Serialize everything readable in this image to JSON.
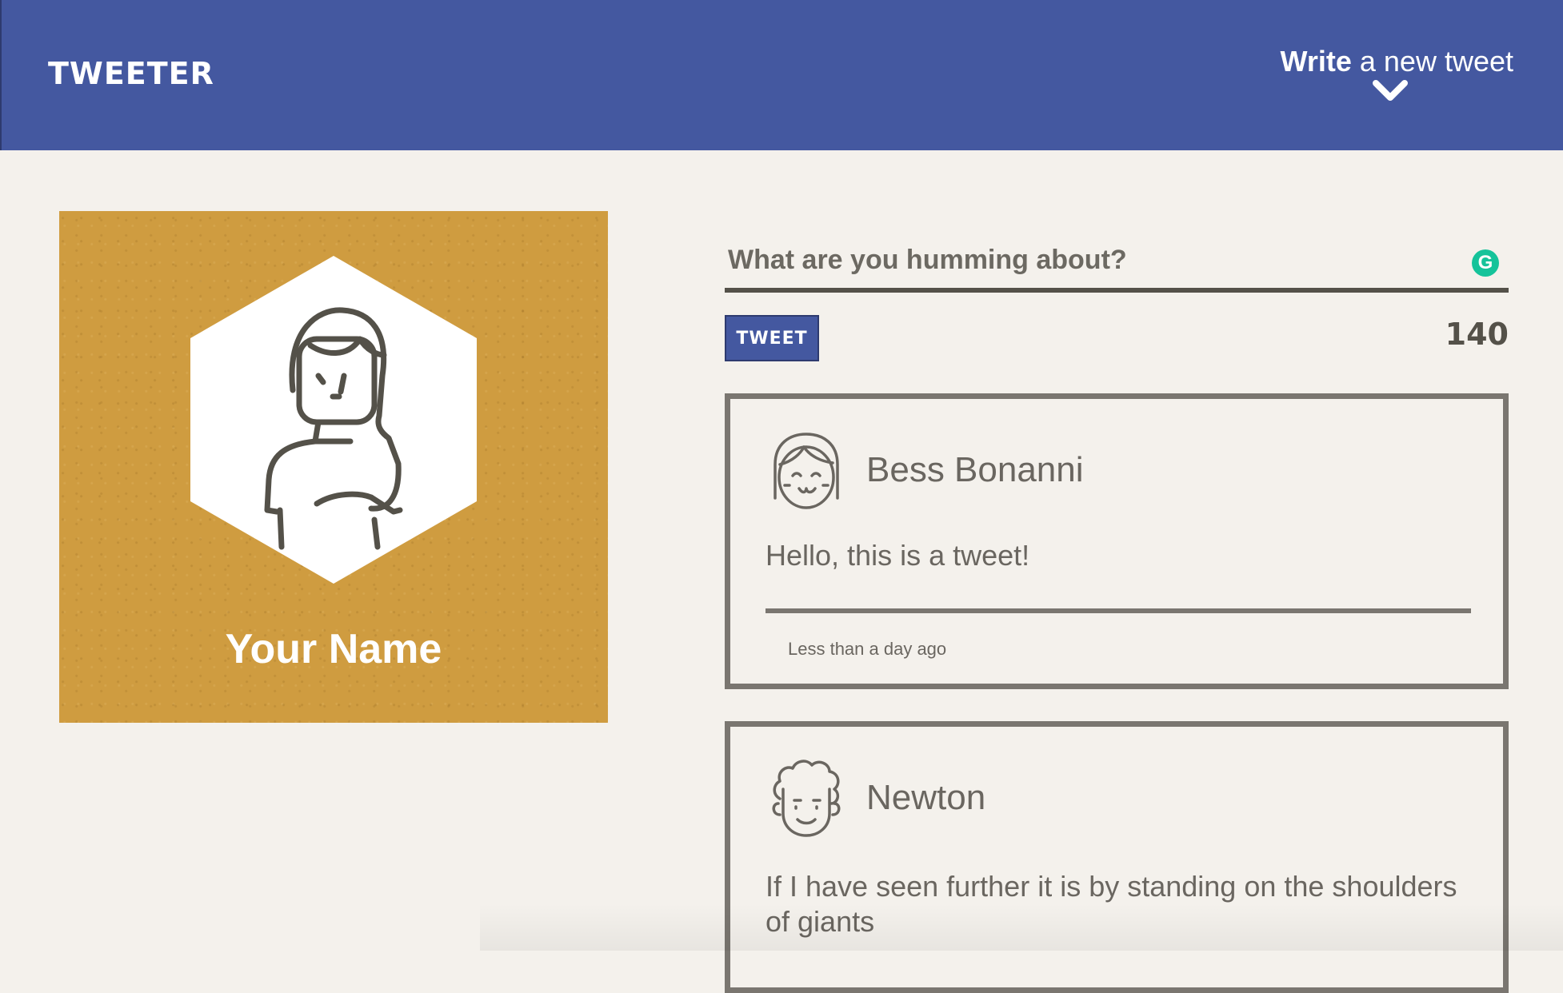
{
  "header": {
    "brand": "TWEETER",
    "compose_bold": "Write",
    "compose_rest": " a new tweet"
  },
  "profile": {
    "name": "Your Name",
    "avatar_icon": "woman-avatar-icon"
  },
  "composer": {
    "placeholder": "What are you humming about?",
    "tweet_label": "TWEET",
    "char_count": "140",
    "grammarly_label": "G"
  },
  "tweets": [
    {
      "author": "Bess Bonanni",
      "avatar_icon": "girl-avatar-icon",
      "text": "Hello, this is a tweet!",
      "timestamp": "Less than a day ago"
    },
    {
      "author": "Newton",
      "avatar_icon": "curly-man-avatar-icon",
      "text": "If I have seen further it is by standing on the shoulders of giants"
    }
  ],
  "colors": {
    "nav": "#4458a0",
    "profile_bg": "#cf9c40",
    "page_bg": "#f4f1ec",
    "text": "#545149",
    "card_border": "#7a7670"
  }
}
